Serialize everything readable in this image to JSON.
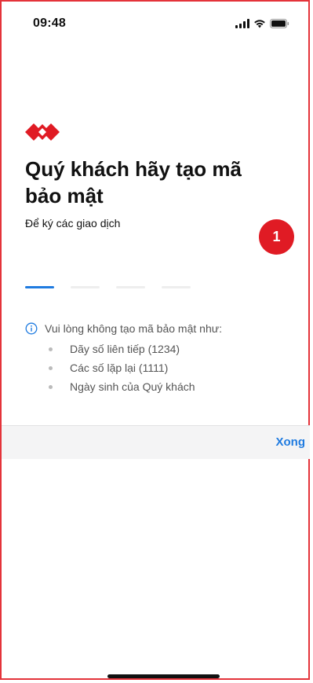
{
  "status_bar": {
    "time": "09:48",
    "icons": [
      "cellular-signal-icon",
      "wifi-icon",
      "battery-icon"
    ]
  },
  "brand": {
    "logo_icon": "bank-logo-icon",
    "logo_color": "#e01b24"
  },
  "header": {
    "title": "Quý khách hãy tạo mã bảo mật",
    "subtitle": "Để ký các giao dịch"
  },
  "step_badge": {
    "label": "1",
    "color": "#e01b24"
  },
  "pin": {
    "length": 4,
    "filled_active_index": 0,
    "active_color": "#1f7be0"
  },
  "hint": {
    "icon": "info-icon",
    "title": "Vui lòng không tạo mã bảo mật như:",
    "items": [
      "Dãy số liên tiếp (1234)",
      "Các số lặp lại (1111)",
      "Ngày sinh của Quý khách"
    ]
  },
  "keyboard_toolbar": {
    "done_label": "Xong"
  },
  "accent_color": "#1f7be0"
}
